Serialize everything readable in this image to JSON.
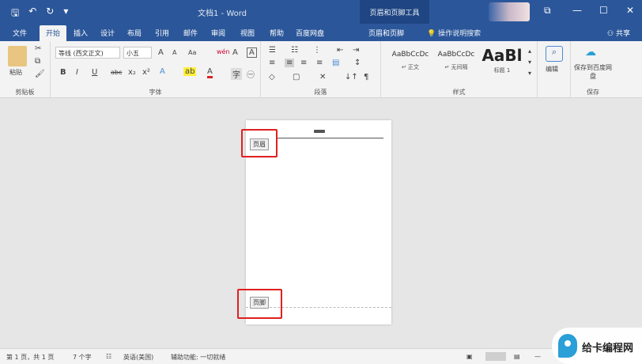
{
  "titlebar": {
    "quick_access": [
      "🖫",
      "↶",
      "↻",
      "▾"
    ],
    "document_title": "文档1 - Word",
    "context_tool": "页眉和页脚工具",
    "window_buttons": [
      "⧉",
      "—",
      "☐",
      "✕"
    ]
  },
  "tabs": [
    "文件",
    "开始",
    "插入",
    "设计",
    "布局",
    "引用",
    "邮件",
    "审阅",
    "视图",
    "帮助",
    "百度网盘",
    "页眉和页脚"
  ],
  "active_tab": "开始",
  "tell_me": "操作说明搜索",
  "share_label": "共享",
  "ribbon": {
    "clipboard": {
      "paste": "粘贴",
      "label": "剪贴板"
    },
    "font": {
      "font_name": "等线 (西文正文)",
      "font_size": "小五",
      "label": "字体",
      "buttons": [
        "A",
        "A",
        "Aa",
        "wén",
        "A",
        "B",
        "I",
        "U",
        "abc",
        "x₂",
        "x²",
        "A",
        "ab",
        "A",
        "字",
        "㊀"
      ]
    },
    "paragraph": {
      "label": "段落"
    },
    "styles": {
      "label": "样式",
      "items": [
        {
          "sample": "AaBbCcDc",
          "name": "↵ 正文"
        },
        {
          "sample": "AaBbCcDc",
          "name": "↵ 无间隔"
        },
        {
          "sample": "AaBl",
          "name": "标题 1"
        }
      ]
    },
    "editing": {
      "label": "编辑"
    },
    "save": {
      "button": "保存到百度网盘",
      "label": "保存"
    }
  },
  "page": {
    "header_tag": "页眉",
    "footer_tag": "页脚"
  },
  "statusbar": {
    "page": "第 1 页，共 1 页",
    "words": "7 个字",
    "language": "英语(美国)",
    "accessibility": "辅助功能: 一切就绪"
  },
  "watermark": "给卡编程网",
  "colors": {
    "brand": "#2b579a",
    "highlight_box": "#e02020"
  }
}
